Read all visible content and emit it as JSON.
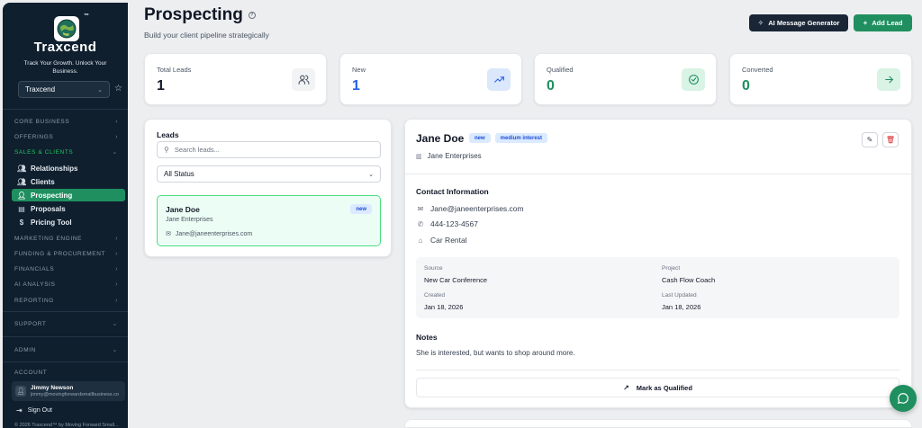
{
  "sidebar": {
    "brand": "Traxcend",
    "trademark": "™",
    "tagline": "Track Your Growth. Unlock Your Business.",
    "workspace": "Traxcend",
    "sections": [
      {
        "label": "CORE BUSINESS"
      },
      {
        "label": "OFFERINGS"
      },
      {
        "label": "SALES & CLIENTS"
      },
      {
        "label": "MARKETING ENGINE"
      },
      {
        "label": "FUNDING & PROCUREMENT"
      },
      {
        "label": "FINANCIALS"
      },
      {
        "label": "AI ANALYSIS"
      },
      {
        "label": "REPORTING"
      },
      {
        "label": "SUPPORT"
      },
      {
        "label": "ADMIN"
      },
      {
        "label": "ACCOUNT"
      }
    ],
    "sales_items": [
      {
        "label": "Relationships",
        "icon": "users-icon"
      },
      {
        "label": "Clients",
        "icon": "users-icon"
      },
      {
        "label": "Prospecting",
        "icon": "user-plus-icon"
      },
      {
        "label": "Proposals",
        "icon": "file-icon"
      },
      {
        "label": "Pricing Tool",
        "icon": "dollar-icon"
      }
    ],
    "user": {
      "name": "Jimmy Newson",
      "email": "jimmy@movingforwardsmallbusiness.com"
    },
    "signout": "Sign Out",
    "copyright": "© 2026 Traxcend™ by Moving Forward Small..."
  },
  "header": {
    "title": "Prospecting",
    "subtitle": "Build your client pipeline strategically",
    "ai_button": "AI Message Generator",
    "add_button": "Add Lead"
  },
  "stats": [
    {
      "label": "Total Leads",
      "value": "1",
      "color": "#111827",
      "icon": "users-icon"
    },
    {
      "label": "New",
      "value": "1",
      "color": "#2563eb",
      "icon": "trending-up-icon"
    },
    {
      "label": "Qualified",
      "value": "0",
      "color": "#1f8f5f",
      "icon": "check-circle-icon"
    },
    {
      "label": "Converted",
      "value": "0",
      "color": "#1f8f5f",
      "icon": "arrow-right-icon"
    }
  ],
  "leads": {
    "title": "Leads",
    "search_placeholder": "Search leads...",
    "status_filter": "All Status",
    "items": [
      {
        "name": "Jane Doe",
        "company": "Jane Enterprises",
        "email": "Jane@janeenterprises.com",
        "status": "new"
      }
    ]
  },
  "detail": {
    "name": "Jane Doe",
    "status_badge": "new",
    "interest_badge": "medium interest",
    "company": "Jane Enterprises",
    "contact_title": "Contact Information",
    "email": "Jane@janeenterprises.com",
    "phone": "444-123-4567",
    "tag": "Car Rental",
    "meta": {
      "source_label": "Source",
      "source": "New Car Conference",
      "project_label": "Project",
      "project": "Cash Flow Coach",
      "created_label": "Created",
      "created": "Jan 18, 2026",
      "updated_label": "Last Updated",
      "updated": "Jan 18, 2026"
    },
    "notes_title": "Notes",
    "notes": "She is interested, but wants to shop around more.",
    "mark_button": "Mark as Qualified"
  },
  "colors": {
    "sidebar_bg": "#0f1f2e",
    "accent_green": "#1f8f5f",
    "accent_blue": "#2563eb"
  }
}
